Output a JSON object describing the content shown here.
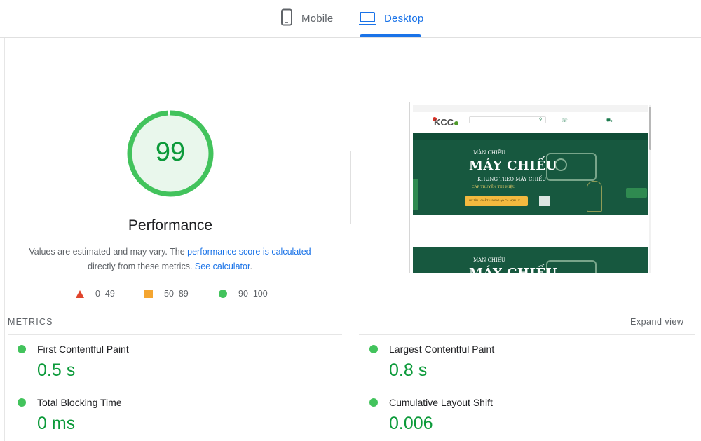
{
  "tabs": {
    "mobile_label": "Mobile",
    "desktop_label": "Desktop",
    "active": "Desktop"
  },
  "score": {
    "value": "99",
    "fraction": 0.99,
    "title": "Performance",
    "color": "#0c9a3a",
    "ring_color": "#42c35c"
  },
  "description": {
    "part1": "Values are estimated and may vary. The ",
    "link1": "performance score is calculated",
    "part2": " directly from these metrics. ",
    "link2": "See calculator",
    "part3": "."
  },
  "legend": {
    "fail": "0–49",
    "average": "50–89",
    "pass": "90–100",
    "fail_color": "#e0442c",
    "average_color": "#f4a530",
    "pass_color": "#42c35c"
  },
  "screenshot": {
    "logo": "KCC",
    "banner_small": "MÀN CHIẾU",
    "banner_big": "MÁY CHIẾU",
    "banner_mid": "KHUNG TREO MÁY CHIẾU",
    "banner_sub": "CÁP TRUYỀN TÍN HIỆU",
    "banner_pill": "UY TÍN - CHẤT LƯỢNG giá CẢ HỢP LÝ",
    "banner_colors": {
      "green": "#17583f",
      "accent": "#f3b93f"
    }
  },
  "metrics": {
    "header": "METRICS",
    "expand_label": "Expand view",
    "items": [
      {
        "label": "First Contentful Paint",
        "value": "0.5 s"
      },
      {
        "label": "Largest Contentful Paint",
        "value": "0.8 s"
      },
      {
        "label": "Total Blocking Time",
        "value": "0 ms"
      },
      {
        "label": "Cumulative Layout Shift",
        "value": "0.006"
      }
    ]
  }
}
